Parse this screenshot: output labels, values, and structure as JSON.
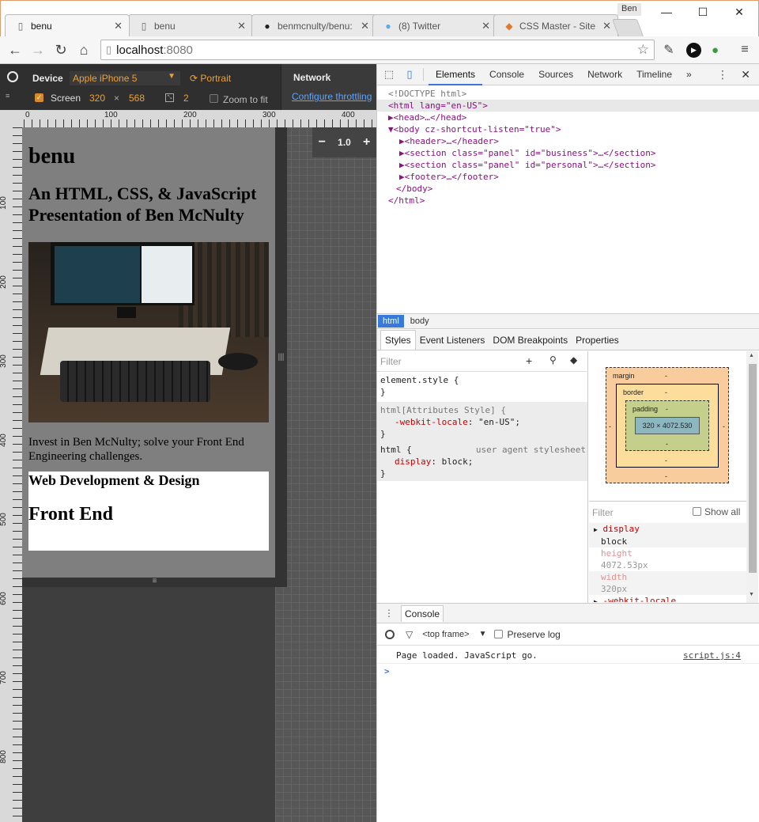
{
  "window": {
    "user": "Ben",
    "minimize_glyph": "—",
    "maximize_glyph": "☐",
    "close_glyph": "✕"
  },
  "tabs": [
    {
      "title": "benu",
      "icon": "page-icon",
      "active": true
    },
    {
      "title": "benu",
      "icon": "page-icon",
      "active": false
    },
    {
      "title": "benmcnulty/benu:",
      "icon": "github-icon",
      "active": false
    },
    {
      "title": "(8) Twitter",
      "icon": "twitter-icon",
      "active": false
    },
    {
      "title": "CSS Master - SiteP",
      "icon": "sitepoint-icon",
      "active": false
    }
  ],
  "toolbar": {
    "url_host": "localhost",
    "url_port": ":8080"
  },
  "emulation": {
    "device_label": "Device",
    "device_value": "Apple iPhone 5",
    "orientation": "Portrait",
    "network_label": "Network",
    "throttle_link": "Configure throttling",
    "screen_label": "Screen",
    "width": "320",
    "times": "×",
    "height": "568",
    "dpr": "2",
    "zoom_to_fit": "Zoom to fit",
    "zoom_level": "1.0",
    "ruler_h": [
      "0",
      "100",
      "200",
      "300",
      "400"
    ],
    "ruler_v": [
      "100",
      "200",
      "300",
      "400",
      "500",
      "600",
      "700",
      "800"
    ]
  },
  "page": {
    "title": "benu",
    "subtitle": "An HTML, CSS, & JavaScript Presentation of Ben McNulty",
    "tagline": "Invest in Ben McNulty; solve your Front End Engineering challenges.",
    "panel_heading": "Web Development & Design",
    "panel_subheading": "Front End"
  },
  "devtools": {
    "tabs": [
      "Elements",
      "Console",
      "Sources",
      "Network",
      "Timeline",
      "»"
    ],
    "dom": [
      {
        "indent": 0,
        "text": "<!DOCTYPE html>",
        "kind": "comment"
      },
      {
        "indent": 0,
        "text": "<html lang=\"en-US\">",
        "kind": "selected"
      },
      {
        "indent": 1,
        "text": "▶<head>…</head>",
        "kind": "tag"
      },
      {
        "indent": 1,
        "text": "▼<body cz-shortcut-listen=\"true\">",
        "kind": "tag"
      },
      {
        "indent": 2,
        "text": "▶<header>…</header>",
        "kind": "tag"
      },
      {
        "indent": 2,
        "text": "▶<section class=\"panel\" id=\"business\">…</section>",
        "kind": "tag"
      },
      {
        "indent": 2,
        "text": "▶<section class=\"panel\" id=\"personal\">…</section>",
        "kind": "tag"
      },
      {
        "indent": 2,
        "text": "▶<footer>…</footer>",
        "kind": "tag"
      },
      {
        "indent": 1,
        "text": "</body>",
        "kind": "tag"
      },
      {
        "indent": 0,
        "text": "</html>",
        "kind": "tag"
      }
    ],
    "breadcrumbs": [
      "html",
      "body"
    ],
    "subtabs": [
      "Styles",
      "Event Listeners",
      "DOM Breakpoints",
      "Properties"
    ],
    "filter_placeholder": "Filter",
    "styles": {
      "element_style": "element.style {",
      "attr_selector": "html[Attributes Style] {",
      "attr_prop": "-webkit-locale",
      "attr_val": "\"en-US\"",
      "ua_selector": "html {",
      "ua_source": "user agent stylesheet",
      "ua_prop": "display",
      "ua_val": "block",
      "close": "}"
    },
    "boxmodel": {
      "margin": "margin",
      "border": "border",
      "padding": "padding",
      "content": "320 × 4072.530",
      "dash": "-"
    },
    "computed": {
      "filter_placeholder": "Filter",
      "show_all": "Show all",
      "props": [
        {
          "name": "display",
          "value": "block",
          "active": true
        },
        {
          "name": "height",
          "value": "4072.53px",
          "active": false
        },
        {
          "name": "width",
          "value": "320px",
          "active": false
        },
        {
          "name": "-webkit-locale",
          "value": "",
          "active": true
        }
      ]
    },
    "console": {
      "tab": "Console",
      "frame": "<top frame>",
      "preserve_log": "Preserve log",
      "message": "Page loaded. JavaScript go.",
      "source": "script.js:4",
      "prompt": ">"
    }
  },
  "colors": {
    "accent": "#3879d9",
    "orange": "#f0a030",
    "page_bg": "#7f7f7f"
  }
}
